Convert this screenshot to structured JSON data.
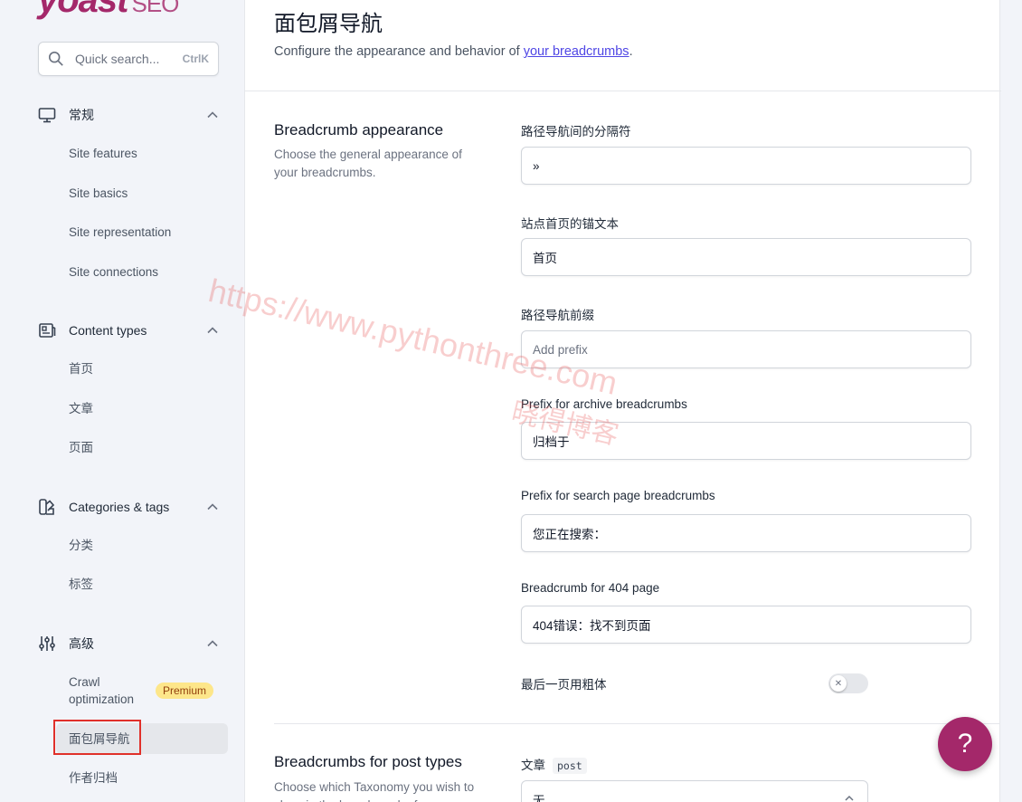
{
  "logo": {
    "brand": "yoast",
    "suffix": "SEO"
  },
  "search": {
    "placeholder": "Quick search...",
    "shortcut": "CtrlK"
  },
  "sidebar": {
    "general": {
      "label": "常规",
      "items": [
        "Site features",
        "Site basics",
        "Site representation",
        "Site connections"
      ]
    },
    "content_types": {
      "label": "Content types",
      "items": [
        "首页",
        "文章",
        "页面"
      ]
    },
    "categories": {
      "label": "Categories & tags",
      "items": [
        "分类",
        "标签"
      ]
    },
    "advanced": {
      "label": "高级",
      "crawl_line1": "Crawl",
      "crawl_line2": "optimization",
      "premium": "Premium",
      "breadcrumbs": "面包屑导航",
      "author": "作者归档"
    }
  },
  "page": {
    "title": "面包屑导航",
    "desc_prefix": "Configure the appearance and behavior of ",
    "desc_link": "your breadcrumbs",
    "desc_suffix": "."
  },
  "appearance": {
    "title": "Breadcrumb appearance",
    "desc": "Choose the general appearance of your breadcrumbs.",
    "fields": {
      "separator": {
        "label": "路径导航间的分隔符",
        "value": "»"
      },
      "home": {
        "label": "站点首页的锚文本",
        "value": "首页"
      },
      "prefix": {
        "label": "路径导航前缀",
        "placeholder": "Add prefix"
      },
      "archive": {
        "label": "Prefix for archive breadcrumbs",
        "value": "归档于"
      },
      "search": {
        "label": "Prefix for search page breadcrumbs",
        "value": "您正在搜索："
      },
      "notfound": {
        "label": "Breadcrumb for 404 page",
        "value": "404错误：找不到页面"
      },
      "bold_last": {
        "label": "最后一页用粗体",
        "enabled": false
      }
    }
  },
  "post_types": {
    "title": "Breadcrumbs for post types",
    "desc": "Choose which Taxonomy you wish to show in the breadcrumbs for",
    "post_label": "文章",
    "post_tag": "post",
    "select_value": "无"
  },
  "help": {
    "label": "?"
  },
  "watermark": {
    "line1": "https://www.pythonthree.com",
    "line2": "晓得博客"
  },
  "colors": {
    "brand": "#a4286a",
    "link": "#4f46e5",
    "premium_bg": "#fde68a",
    "highlight": "#e0302a"
  }
}
